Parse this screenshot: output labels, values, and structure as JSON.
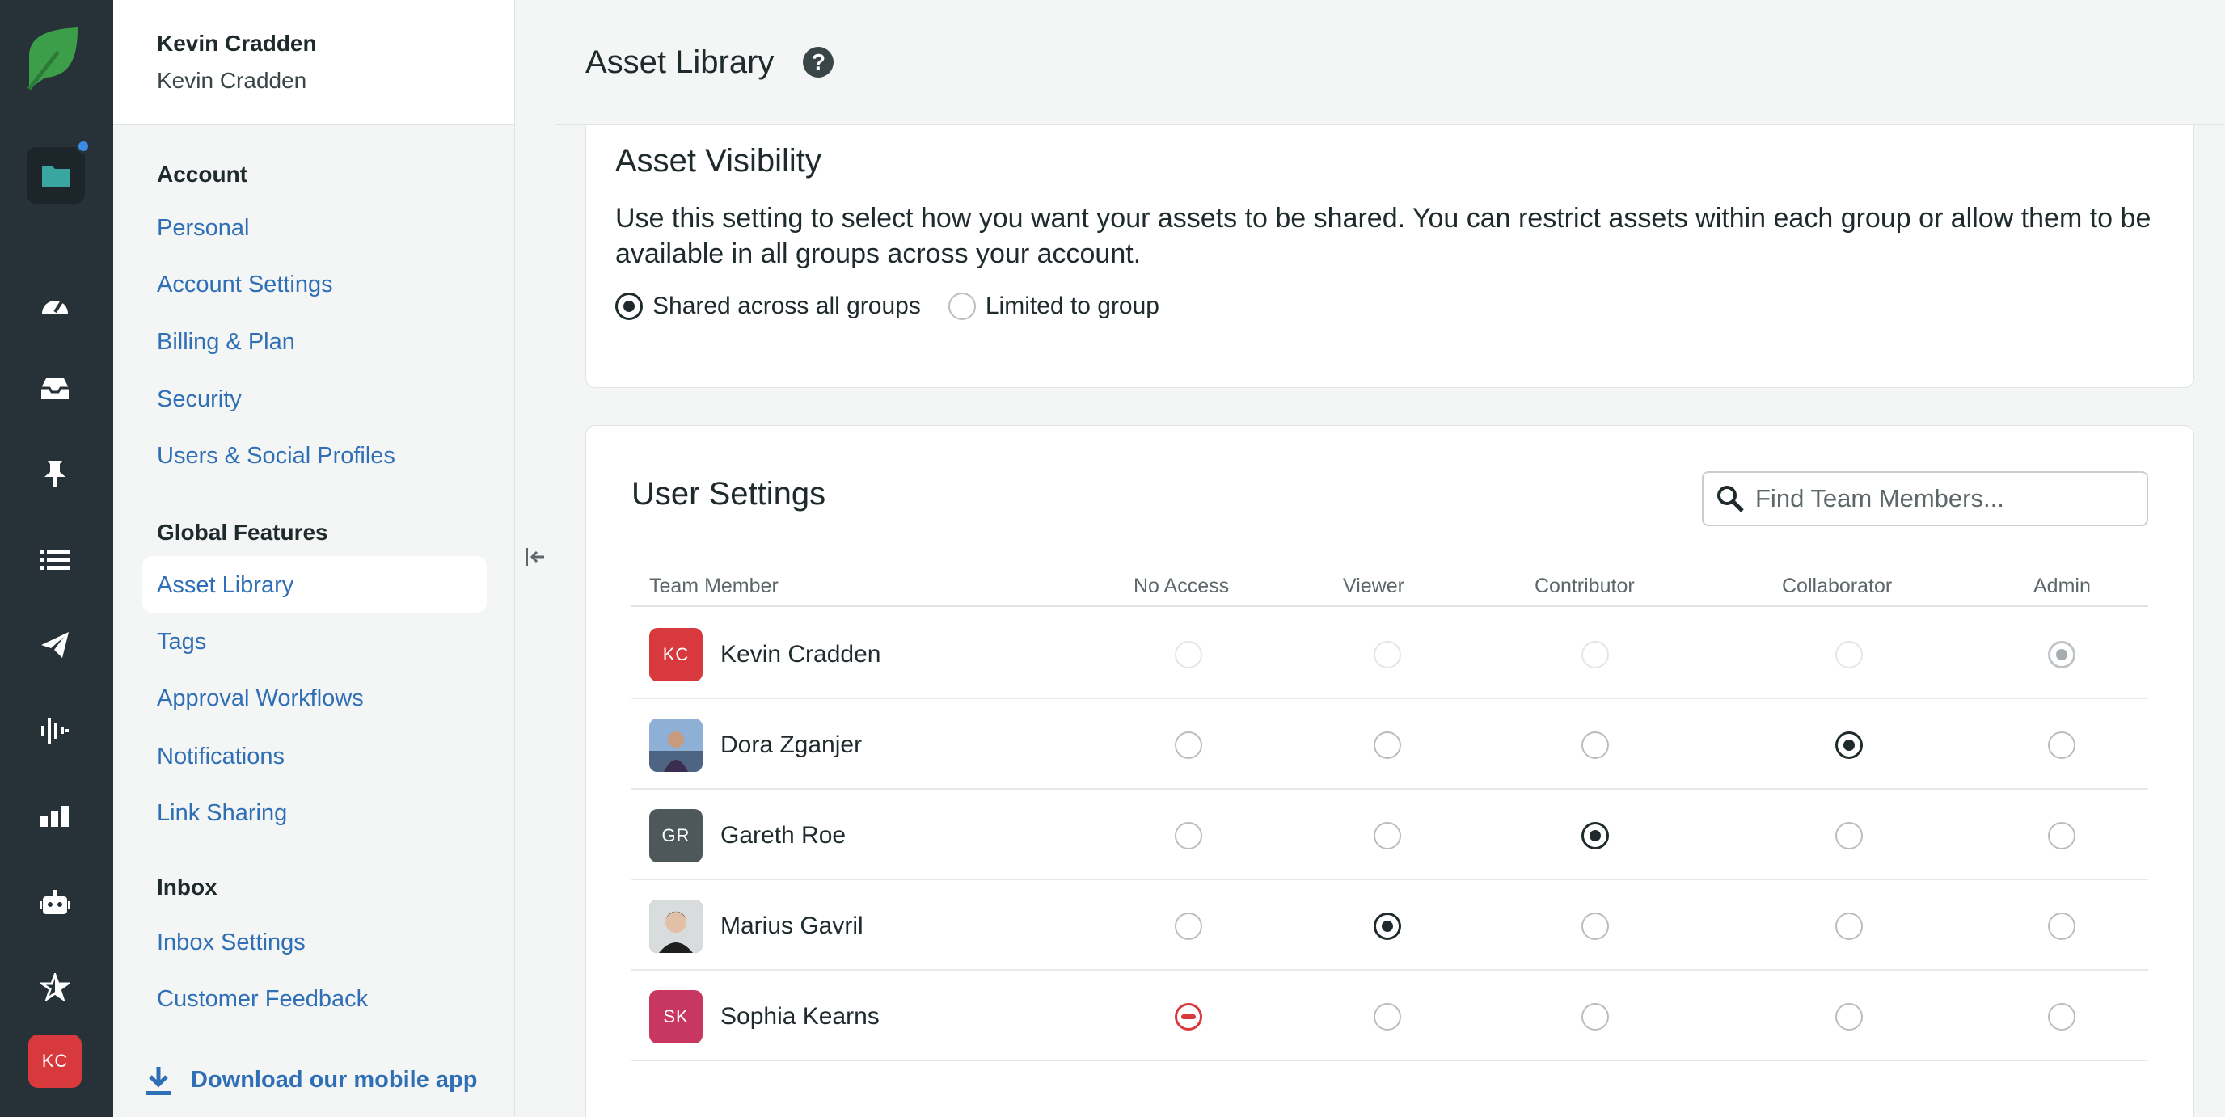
{
  "app": {
    "brand_color": "#3d9e4a",
    "rail_icons": [
      "leaf-logo-icon",
      "folder-icon",
      "dashboard-gauge-icon",
      "inbox-tray-icon",
      "pin-icon",
      "list-icon",
      "paper-plane-icon",
      "audio-waves-icon",
      "bar-chart-icon",
      "robot-icon",
      "star-icon"
    ],
    "avatar_initials": "KC"
  },
  "sidebar": {
    "user_name": "Kevin Cradden",
    "user_subname": "Kevin Cradden",
    "account_heading": "Account",
    "account_links": [
      "Personal",
      "Account Settings",
      "Billing & Plan",
      "Security",
      "Users & Social Profiles"
    ],
    "features_heading": "Global Features",
    "features_links": [
      "Asset Library",
      "Tags",
      "Approval Workflows",
      "Notifications",
      "Link Sharing"
    ],
    "inbox_heading": "Inbox",
    "inbox_links": [
      "Inbox Settings",
      "Customer Feedback"
    ],
    "download_label": "Download our mobile app"
  },
  "header": {
    "title": "Asset Library",
    "help_glyph": "?"
  },
  "visibility": {
    "heading": "Asset Visibility",
    "description": "Use this setting to select how you want your assets to be shared. You can restrict assets within each group or allow them to be available in all groups across your account.",
    "options": [
      "Shared across all groups",
      "Limited to group"
    ],
    "selected": "Shared across all groups"
  },
  "user_settings": {
    "heading": "User Settings",
    "search_placeholder": "Find Team Members...",
    "columns": [
      "Team Member",
      "No Access",
      "Viewer",
      "Contributor",
      "Collaborator",
      "Admin"
    ],
    "rows": [
      {
        "name": "Kevin Cradden",
        "initials": "KC",
        "avatar_color": "#d8393d",
        "role": "Admin",
        "locked": true
      },
      {
        "name": "Dora Zganjer",
        "initials": "",
        "avatar_color": "#6f8fb5",
        "role": "Collaborator",
        "locked": false
      },
      {
        "name": "Gareth Roe",
        "initials": "GR",
        "avatar_color": "#4e5759",
        "role": "Contributor",
        "locked": false
      },
      {
        "name": "Marius Gavril",
        "initials": "",
        "avatar_color": "#3a3f42",
        "role": "Viewer",
        "locked": false
      },
      {
        "name": "Sophia Kearns",
        "initials": "SK",
        "avatar_color": "#c8375f",
        "role": "No Access",
        "locked": false
      }
    ]
  }
}
